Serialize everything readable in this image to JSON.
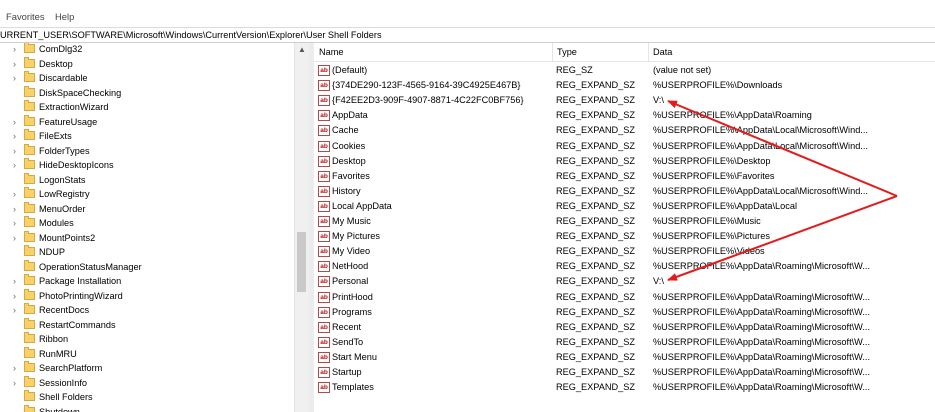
{
  "menu": {
    "favorites": "Favorites",
    "help": "Help"
  },
  "address": "URRENT_USER\\SOFTWARE\\Microsoft\\Windows\\CurrentVersion\\Explorer\\User Shell Folders",
  "tree": {
    "items": [
      {
        "label": "ComDlg32",
        "expandable": true
      },
      {
        "label": "Desktop",
        "expandable": true
      },
      {
        "label": "Discardable",
        "expandable": true
      },
      {
        "label": "DiskSpaceChecking",
        "expandable": false
      },
      {
        "label": "ExtractionWizard",
        "expandable": false
      },
      {
        "label": "FeatureUsage",
        "expandable": true
      },
      {
        "label": "FileExts",
        "expandable": true
      },
      {
        "label": "FolderTypes",
        "expandable": true
      },
      {
        "label": "HideDesktopIcons",
        "expandable": true
      },
      {
        "label": "LogonStats",
        "expandable": false
      },
      {
        "label": "LowRegistry",
        "expandable": true
      },
      {
        "label": "MenuOrder",
        "expandable": true
      },
      {
        "label": "Modules",
        "expandable": true
      },
      {
        "label": "MountPoints2",
        "expandable": true
      },
      {
        "label": "NDUP",
        "expandable": false
      },
      {
        "label": "OperationStatusManager",
        "expandable": false
      },
      {
        "label": "Package Installation",
        "expandable": true
      },
      {
        "label": "PhotoPrintingWizard",
        "expandable": true
      },
      {
        "label": "RecentDocs",
        "expandable": true
      },
      {
        "label": "RestartCommands",
        "expandable": false
      },
      {
        "label": "Ribbon",
        "expandable": false
      },
      {
        "label": "RunMRU",
        "expandable": false
      },
      {
        "label": "SearchPlatform",
        "expandable": true
      },
      {
        "label": "SessionInfo",
        "expandable": true
      },
      {
        "label": "Shell Folders",
        "expandable": false
      },
      {
        "label": "Shutdown",
        "expandable": false
      }
    ]
  },
  "list": {
    "headers": {
      "name": "Name",
      "type": "Type",
      "data": "Data"
    },
    "icon_text": "ab",
    "rows": [
      {
        "name": "(Default)",
        "type": "REG_SZ",
        "data": "(value not set)"
      },
      {
        "name": "{374DE290-123F-4565-9164-39C4925E467B}",
        "type": "REG_EXPAND_SZ",
        "data": "%USERPROFILE%\\Downloads"
      },
      {
        "name": "{F42EE2D3-909F-4907-8871-4C22FC0BF756}",
        "type": "REG_EXPAND_SZ",
        "data": "V:\\"
      },
      {
        "name": "AppData",
        "type": "REG_EXPAND_SZ",
        "data": "%USERPROFILE%\\AppData\\Roaming"
      },
      {
        "name": "Cache",
        "type": "REG_EXPAND_SZ",
        "data": "%USERPROFILE%\\AppData\\Local\\Microsoft\\Wind..."
      },
      {
        "name": "Cookies",
        "type": "REG_EXPAND_SZ",
        "data": "%USERPROFILE%\\AppData\\Local\\Microsoft\\Wind..."
      },
      {
        "name": "Desktop",
        "type": "REG_EXPAND_SZ",
        "data": "%USERPROFILE%\\Desktop"
      },
      {
        "name": "Favorites",
        "type": "REG_EXPAND_SZ",
        "data": "%USERPROFILE%\\Favorites"
      },
      {
        "name": "History",
        "type": "REG_EXPAND_SZ",
        "data": "%USERPROFILE%\\AppData\\Local\\Microsoft\\Wind..."
      },
      {
        "name": "Local AppData",
        "type": "REG_EXPAND_SZ",
        "data": "%USERPROFILE%\\AppData\\Local"
      },
      {
        "name": "My Music",
        "type": "REG_EXPAND_SZ",
        "data": "%USERPROFILE%\\Music"
      },
      {
        "name": "My Pictures",
        "type": "REG_EXPAND_SZ",
        "data": "%USERPROFILE%\\Pictures"
      },
      {
        "name": "My Video",
        "type": "REG_EXPAND_SZ",
        "data": "%USERPROFILE%\\Videos"
      },
      {
        "name": "NetHood",
        "type": "REG_EXPAND_SZ",
        "data": "%USERPROFILE%\\AppData\\Roaming\\Microsoft\\W..."
      },
      {
        "name": "Personal",
        "type": "REG_EXPAND_SZ",
        "data": "V:\\"
      },
      {
        "name": "PrintHood",
        "type": "REG_EXPAND_SZ",
        "data": "%USERPROFILE%\\AppData\\Roaming\\Microsoft\\W..."
      },
      {
        "name": "Programs",
        "type": "REG_EXPAND_SZ",
        "data": "%USERPROFILE%\\AppData\\Roaming\\Microsoft\\W..."
      },
      {
        "name": "Recent",
        "type": "REG_EXPAND_SZ",
        "data": "%USERPROFILE%\\AppData\\Roaming\\Microsoft\\W..."
      },
      {
        "name": "SendTo",
        "type": "REG_EXPAND_SZ",
        "data": "%USERPROFILE%\\AppData\\Roaming\\Microsoft\\W..."
      },
      {
        "name": "Start Menu",
        "type": "REG_EXPAND_SZ",
        "data": "%USERPROFILE%\\AppData\\Roaming\\Microsoft\\W..."
      },
      {
        "name": "Startup",
        "type": "REG_EXPAND_SZ",
        "data": "%USERPROFILE%\\AppData\\Roaming\\Microsoft\\W..."
      },
      {
        "name": "Templates",
        "type": "REG_EXPAND_SZ",
        "data": "%USERPROFILE%\\AppData\\Roaming\\Microsoft\\W..."
      }
    ]
  },
  "annotation": {
    "arrow_color": "#e31b1b"
  }
}
